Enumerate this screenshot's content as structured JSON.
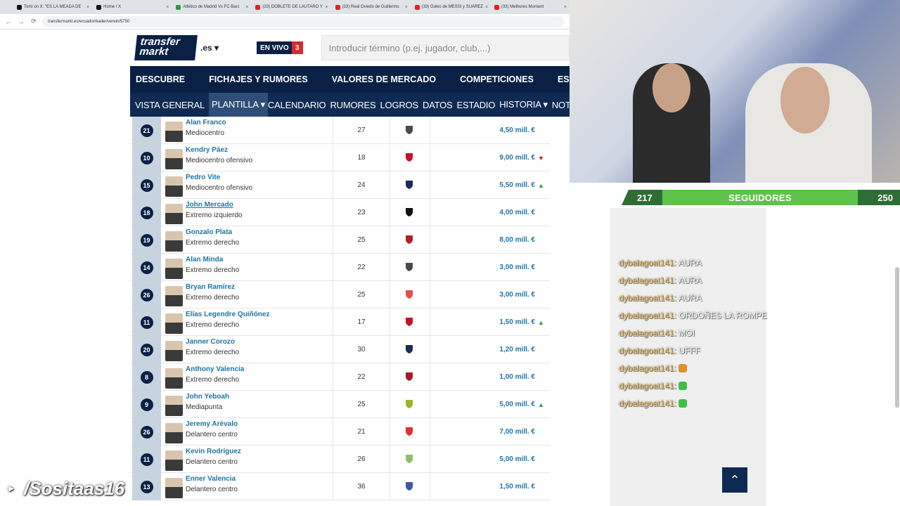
{
  "browser": {
    "tabs": [
      {
        "label": "Tomi on X: \"ES LA MEADA DE",
        "color": "#111111"
      },
      {
        "label": "Home / X",
        "color": "#111111"
      },
      {
        "label": "Atlético de Madrid Vs FC Barc",
        "color": "#2a9d3a"
      },
      {
        "label": "(33) DOBLETE DE LAUTARO Y",
        "color": "#e02020"
      },
      {
        "label": "(33) Real Oviedo de Guillermo",
        "color": "#e02020"
      },
      {
        "label": "(33) Goles de MESSI y SUAREZ",
        "color": "#e02020"
      },
      {
        "label": "(33) Melhores Moment",
        "color": "#e02020"
      }
    ],
    "url": "transfermarkt.es/ecuador/kader/verein/5750"
  },
  "site": {
    "logo_line1": "transfer",
    "logo_line2": "markt",
    "domain": ".es",
    "live_label": "EN VIVO",
    "live_count": "3",
    "search_placeholder": "Introducir término (p.ej. jugador, club,...)",
    "main_nav": [
      "DESCUBRE",
      "FICHAJES Y RUMORES",
      "VALORES DE MERCADO",
      "COMPETICIONES",
      "ESTADÍSTIC"
    ],
    "sub_nav": [
      "VISTA GENERAL",
      "PLANTILLA ▾",
      "CALENDARIO",
      "RUMORES",
      "LOGROS",
      "DATOS",
      "ESTADIO",
      "HISTORIA ▾",
      "NOTICIAS"
    ]
  },
  "players": [
    {
      "number": "21",
      "name": "Alan Franco",
      "position": "Mediocentro",
      "age": "27",
      "value": "4,50 mill. €",
      "trend": "",
      "club_color": "#4a4a4a"
    },
    {
      "number": "10",
      "name": "Kendry Páez",
      "position": "Mediocentro ofensivo",
      "age": "18",
      "value": "9,00 mill. €",
      "trend": "down",
      "club_color": "#c8102e"
    },
    {
      "number": "15",
      "name": "Pedro Vite",
      "position": "Mediocentro ofensivo",
      "age": "24",
      "value": "5,50 mill. €",
      "trend": "up",
      "club_color": "#1d2a57"
    },
    {
      "number": "18",
      "name": "John Mercado",
      "position": "Extremo izquierdo",
      "age": "23",
      "value": "4,00 mill. €",
      "trend": "",
      "club_color": "#111111"
    },
    {
      "number": "19",
      "name": "Gonzalo Plata",
      "position": "Extremo derecho",
      "age": "25",
      "value": "8,00 mill. €",
      "trend": "",
      "club_color": "#b0202a"
    },
    {
      "number": "14",
      "name": "Alan Minda",
      "position": "Extremo derecho",
      "age": "22",
      "value": "3,00 mill. €",
      "trend": "",
      "club_color": "#4a4a4a"
    },
    {
      "number": "26",
      "name": "Bryan Ramírez",
      "position": "Extremo derecho",
      "age": "25",
      "value": "3,00 mill. €",
      "trend": "",
      "club_color": "#e05050"
    },
    {
      "number": "11",
      "name": "Elías Legendre Quiñónez",
      "position": "Extremo derecho",
      "age": "17",
      "value": "1,50 mill. €",
      "trend": "up",
      "club_color": "#c8102e"
    },
    {
      "number": "20",
      "name": "Janner Corozo",
      "position": "Extremo derecho",
      "age": "30",
      "value": "1,20 mill. €",
      "trend": "",
      "club_color": "#1d2a57"
    },
    {
      "number": "8",
      "name": "Anthony Valencia",
      "position": "Extremo derecho",
      "age": "22",
      "value": "1,00 mill. €",
      "trend": "",
      "club_color": "#a01c2c"
    },
    {
      "number": "9",
      "name": "John Yeboah",
      "position": "Mediapunta",
      "age": "25",
      "value": "5,00 mill. €",
      "trend": "up",
      "club_color": "#9ab52a"
    },
    {
      "number": "26",
      "name": "Jeremy Arévalo",
      "position": "Delantero centro",
      "age": "21",
      "value": "7,00 mill. €",
      "trend": "",
      "club_color": "#e03030"
    },
    {
      "number": "11",
      "name": "Kevin Rodríguez",
      "position": "Delantero centro",
      "age": "26",
      "value": "5,00 mill. €",
      "trend": "",
      "club_color": "#8fbf6a"
    },
    {
      "number": "13",
      "name": "Enner Valencia",
      "position": "Delantero centro",
      "age": "36",
      "value": "1,50 mill. €",
      "trend": "",
      "club_color": "#3a5aa0"
    }
  ],
  "stream": {
    "followers_current": "217",
    "followers_label": "SEGUIDORES",
    "followers_goal": "250",
    "chat": [
      {
        "user": "dybalagoat141:",
        "text": "AURA"
      },
      {
        "user": "dybalagoat141:",
        "text": "AURA"
      },
      {
        "user": "dybalagoat141:",
        "text": "AURA"
      },
      {
        "user": "dybalagoat141:",
        "text": "ORDOÑES LA ROMPE"
      },
      {
        "user": "dybalagoat141:",
        "text": "MOI"
      },
      {
        "user": "dybalagoat141:",
        "text": "UFFF"
      },
      {
        "user": "dybalagoat141:",
        "text": "",
        "emote": "orange-emote"
      },
      {
        "user": "dybalagoat141:",
        "text": "",
        "emote": "green-emote"
      },
      {
        "user": "dybalagoat141:",
        "text": "",
        "emote": "green-emote"
      }
    ],
    "watermark": "/Sositaas16"
  },
  "colors": {
    "nav": "#0a2145",
    "link": "#1d75a3",
    "up": "#2e9e3a",
    "down": "#d11b1b"
  }
}
